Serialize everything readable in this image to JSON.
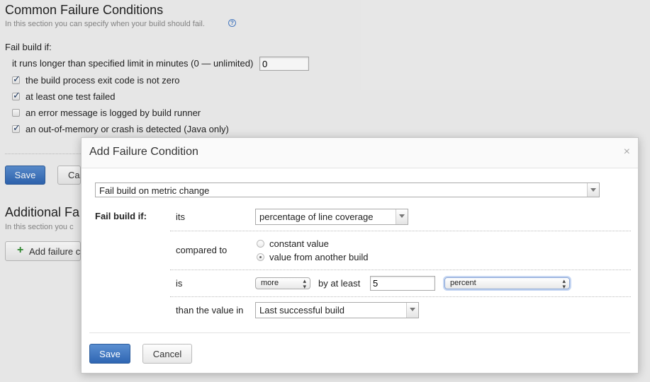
{
  "common": {
    "title": "Common Failure Conditions",
    "hint": "In this section you can specify when your build should fail.",
    "help_icon": "?",
    "fail_build_if": "Fail build if:",
    "time_limit_label": "it runs longer than specified limit in minutes (0 — unlimited)",
    "time_limit_value": "0",
    "conditions": [
      {
        "label": "the build process exit code is not zero",
        "checked": true
      },
      {
        "label": "at least one test failed",
        "checked": true
      },
      {
        "label": "an error message is logged by build runner",
        "checked": false
      },
      {
        "label": "an out-of-memory or crash is detected (Java only)",
        "checked": true
      }
    ],
    "save_label": "Save",
    "cancel_label": "Ca"
  },
  "additional": {
    "title": "Additional Fa",
    "hint": "In this section you c",
    "add_button_icon": "+",
    "add_button_label": "Add failure c"
  },
  "dialog": {
    "title": "Add Failure Condition",
    "close_glyph": "×",
    "condition_type": "Fail build on metric change",
    "fail_build_if": "Fail build if:",
    "its_label": "its",
    "metric_value": "percentage of line coverage",
    "compared_to_label": "compared to",
    "radio_options": [
      {
        "label": "constant value",
        "selected": false
      },
      {
        "label": "value from another build",
        "selected": true
      }
    ],
    "is_label": "is",
    "direction_value": "more",
    "by_at_least_label": "by at least",
    "threshold_value": "5",
    "unit_value": "percent",
    "than_label": "than the value in",
    "build_value": "Last successful build",
    "save_label": "Save",
    "cancel_label": "Cancel"
  },
  "icons": {
    "checkbox_checked": "check-icon",
    "dropdown": "chevron-down-icon",
    "stepper": "updown-icon"
  },
  "colors": {
    "primary_button": "#2f66b3",
    "add_icon": "#2e8b2e",
    "link_blue": "#4a7ec7"
  }
}
